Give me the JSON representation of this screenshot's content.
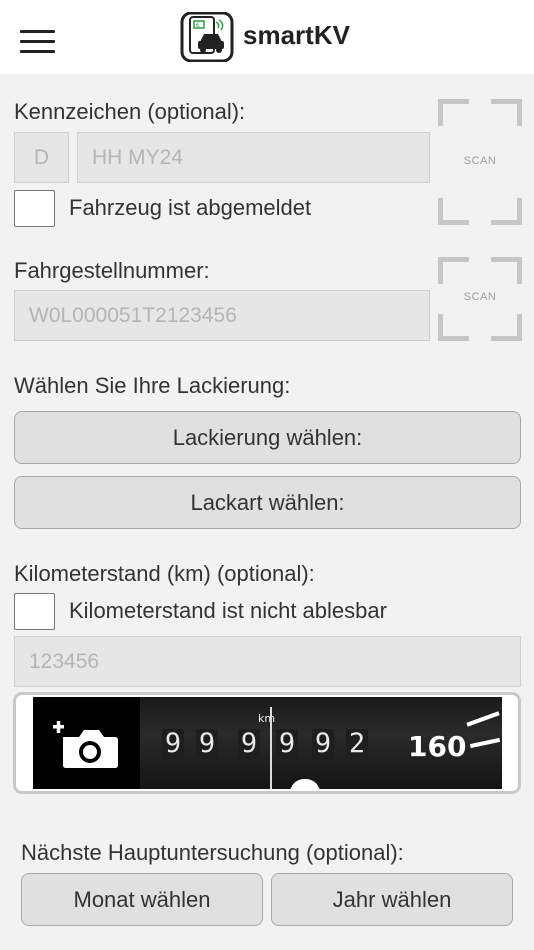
{
  "header": {
    "title": "smartKV",
    "menu_icon": "hamburger-menu-icon",
    "logo_icon": "smartkv-logo-icon"
  },
  "plate": {
    "label": "Kennzeichen (optional):",
    "country_placeholder": "D",
    "number_placeholder": "HH MY24",
    "deregistered_label": "Fahrzeug ist abgemeldet",
    "scan_label": "SCAN"
  },
  "vin": {
    "label": "Fahrgestellnummer:",
    "placeholder": "W0L000051T2123456",
    "scan_label": "SCAN"
  },
  "paint": {
    "label": "Wählen Sie Ihre Lackierung:",
    "paint_button": "Lackierung wählen:",
    "type_button": "Lackart wählen:"
  },
  "mileage": {
    "label": "Kilometerstand (km) (optional):",
    "unreadable_label": "Kilometerstand ist nicht ablesbar",
    "placeholder": "123456",
    "photo": {
      "add_photo_icon": "add-photo-camera-icon",
      "unit": "km",
      "odometer_digits": [
        "9",
        "9",
        "9",
        "9",
        "9",
        "2"
      ],
      "speed_label": "160"
    }
  },
  "inspection": {
    "label": "Nächste Hauptuntersuchung (optional):",
    "month_button": "Monat wählen",
    "year_button": "Jahr wählen"
  },
  "colors": {
    "background": "#f2f2f2",
    "input_bg": "#e6e6e6",
    "button_bg": "#e0e0e0",
    "accent": "#2f9e44"
  }
}
